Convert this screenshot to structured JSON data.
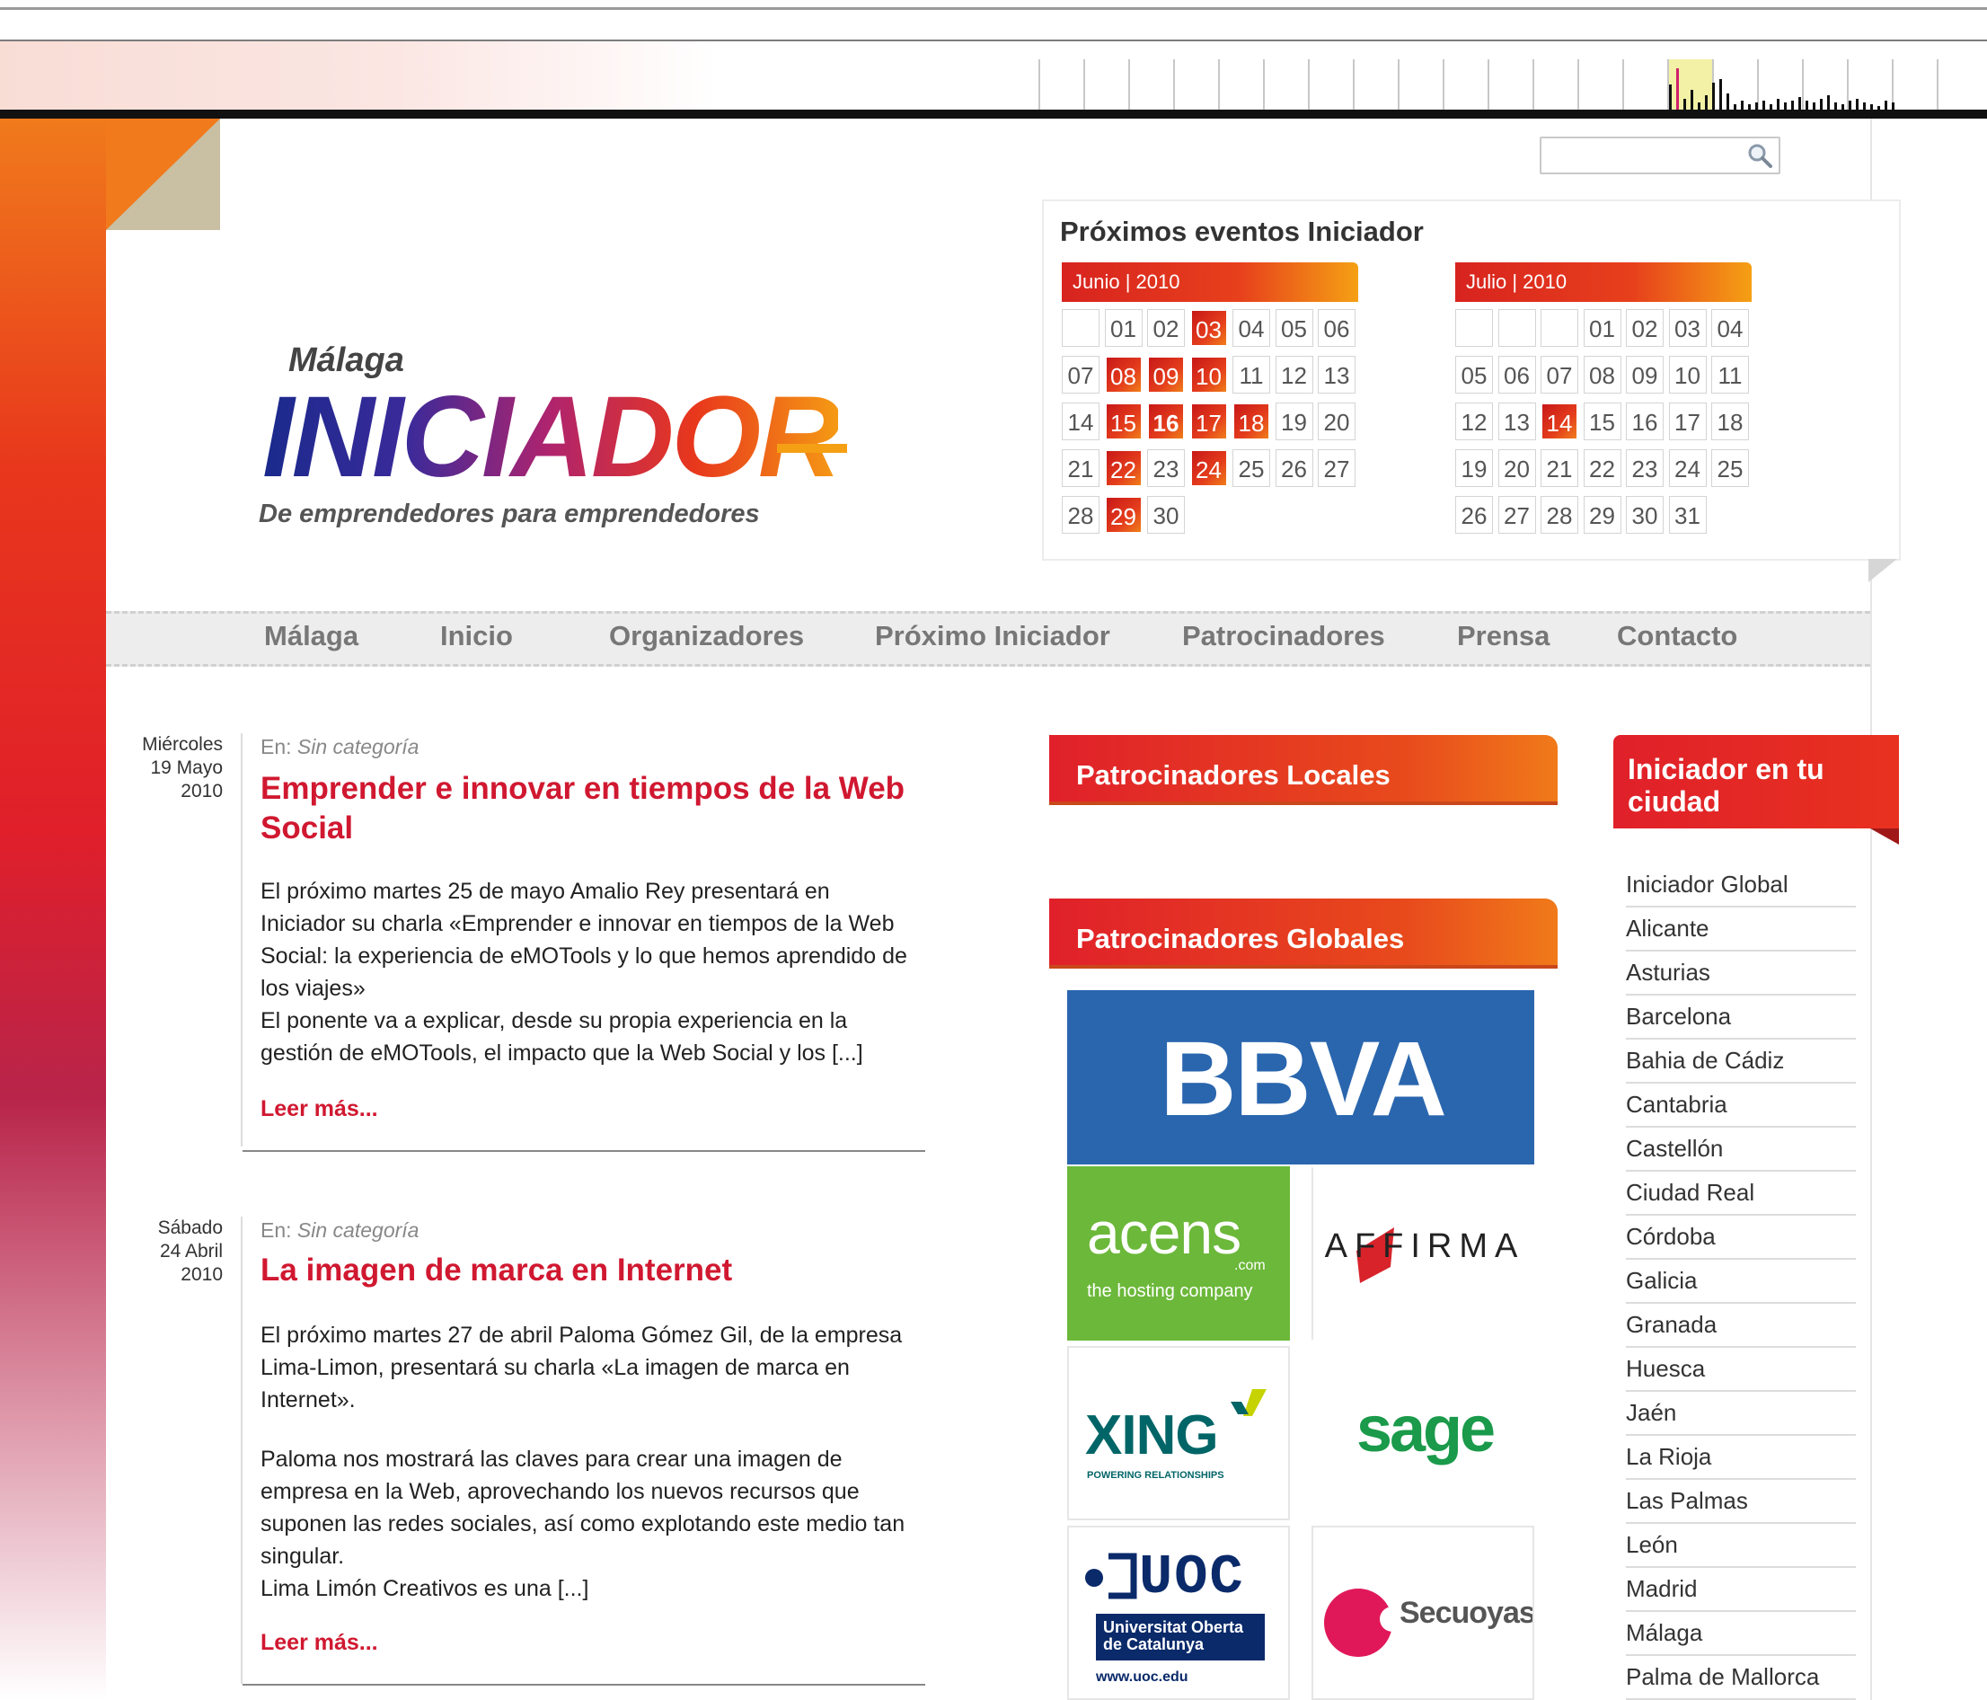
{
  "search": {
    "placeholder": "",
    "value": ""
  },
  "logo": {
    "city": "Málaga",
    "name": "INICIADOR",
    "tagline": "De emprendedores para emprendedores"
  },
  "events": {
    "title": "Próximos eventos Iniciador",
    "months": [
      {
        "label": "Junio | 2010",
        "offset": 1,
        "days": 30,
        "event_days": [
          3,
          8,
          9,
          10,
          15,
          16,
          17,
          18,
          22,
          24,
          29
        ],
        "bold_days": [
          16
        ]
      },
      {
        "label": "Julio | 2010",
        "offset": 3,
        "days": 31,
        "event_days": [
          14
        ],
        "bold_days": []
      }
    ]
  },
  "nav": [
    "Málaga",
    "Inicio",
    "Organizadores",
    "Próximo Iniciador",
    "Patrocinadores",
    "Prensa",
    "Contacto"
  ],
  "posts": [
    {
      "weekday": "Miércoles",
      "daymonth": "19 Mayo",
      "year": "2010",
      "cat_label": "En:",
      "category": "Sin categoría",
      "title": "Emprender e innovar en tiempos de la Web Social",
      "paragraphs": [
        "El próximo martes 25 de mayo Amalio Rey presentará en Iniciador su charla «Emprender e innovar en tiempos de la Web Social: la experiencia de eMOTools y lo que hemos aprendido de los viajes»",
        "El ponente va a explicar, desde su propia experiencia en la gestión de eMOTools, el impacto que la Web Social y los [...]"
      ],
      "read_more": "Leer más..."
    },
    {
      "weekday": "Sábado",
      "daymonth": "24 Abril",
      "year": "2010",
      "cat_label": "En:",
      "category": "Sin categoría",
      "title": "La imagen de marca en Internet",
      "paragraphs": [
        "El próximo martes 27 de abril Paloma Gómez Gil, de la empresa Lima-Limon, presentará su charla «La imagen de marca en Internet».",
        "Paloma nos mostrará las claves para crear una imagen de empresa en la Web, aprovechando los nuevos recursos que suponen las redes sociales, así como explotando este medio tan singular.",
        "Lima Limón Creativos es una [...]"
      ],
      "read_more": "Leer más..."
    }
  ],
  "sponsors": {
    "local_title": "Patrocinadores Locales",
    "global_title": "Patrocinadores Globales",
    "logos": {
      "bbva": "BBVA",
      "acens": "acens",
      "acens_com": ".com",
      "acens_tag": "the hosting company",
      "affirma": "AFFIRMA",
      "xing": "XING",
      "xing_tag": "POWERING RELATIONSHIPS",
      "sage": "sage",
      "uoc": "UOC",
      "uoc_name1": "Universitat Oberta",
      "uoc_name2": "de Catalunya",
      "uoc_url": "www.uoc.edu",
      "secuoyas": "Secuoyas"
    }
  },
  "cities": {
    "title": "Iniciador en tu ciudad",
    "items": [
      "Iniciador Global",
      "Alicante",
      "Asturias",
      "Barcelona",
      "Bahia de Cádiz",
      "Cantabria",
      "Castellón",
      "Ciudad Real",
      "Córdoba",
      "Galicia",
      "Granada",
      "Huesca",
      "Jaén",
      "La Rioja",
      "Las Palmas",
      "León",
      "Madrid",
      "Málaga",
      "Palma de Mallorca"
    ]
  },
  "colors": {
    "accent": "#d01830",
    "orange": "#f07a1a",
    "bbva_blue": "#2a66ae",
    "acens_green": "#6cb83a"
  }
}
